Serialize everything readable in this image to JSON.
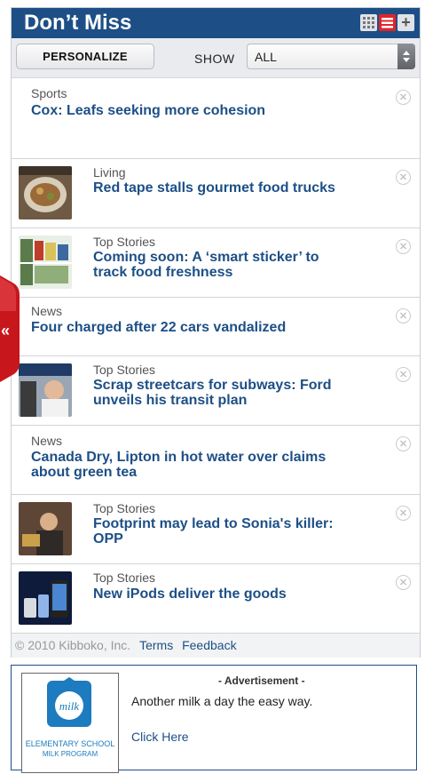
{
  "header": {
    "title": "Don’t Miss"
  },
  "toolbar": {
    "personalize_label": "PERSONALIZE",
    "show_label": "SHOW",
    "show_value": "ALL"
  },
  "news": [
    {
      "category": "Sports",
      "headline": "Cox: Leafs seeking more cohesion"
    },
    {
      "category": "Living",
      "headline": "Red tape stalls gourmet food trucks"
    },
    {
      "category": "Top Stories",
      "headline_line1": "Coming soon: A ‘smart sticker’ to",
      "headline_line2": "track food freshness"
    },
    {
      "category": "News",
      "headline": "Four charged after 22 cars vandalized"
    },
    {
      "category": "Top Stories",
      "headline_line1": "Scrap streetcars for subways: Ford",
      "headline_line2": "unveils his transit plan"
    },
    {
      "category": "News",
      "headline_line1": "Canada Dry, Lipton in hot water over claims",
      "headline_line2": "about green tea"
    },
    {
      "category": "Top Stories",
      "headline_line1": "Footprint may lead to Sonia's killer:",
      "headline_line2": "OPP"
    },
    {
      "category": "Top Stories",
      "headline": "New iPods deliver the goods"
    }
  ],
  "footer": {
    "copyright": "© 2010 Kibboko, Inc.",
    "terms": "Terms",
    "feedback": "Feedback"
  },
  "ad": {
    "label": "- Advertisement -",
    "logo_text_line1": "ELEMENTARY SCHOOL",
    "logo_text_line2": "MILK PROGRAM",
    "logo_word": "milk",
    "text": "Another milk a day the easy way.",
    "link": "Click Here"
  },
  "colors": {
    "header": "#1d4f86",
    "accent": "#e0242b",
    "link": "#1d4f86"
  }
}
